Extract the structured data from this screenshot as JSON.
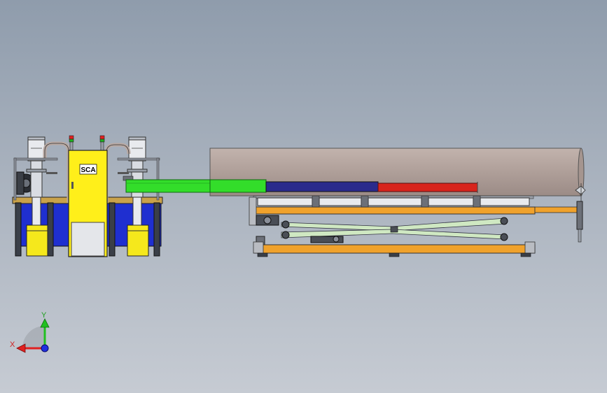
{
  "cabinet": {
    "label": "SCA"
  },
  "triad": {
    "x_label": "X",
    "y_label": "Y"
  },
  "colors": {
    "background_top": "#8f9cac",
    "background_bottom": "#c6cbd3",
    "tank_blue": "#1f2fd0",
    "cabinet_yellow": "#ffef1a",
    "barrel_yellow": "#f5e81c",
    "pipe_grey": "#b9a9a3",
    "green_rod": "#33dd2a",
    "navy_rod": "#2a2a8c",
    "red_rod": "#d8241c",
    "frame_orange": "#f0a22c",
    "roller_green": "#cfe8c2",
    "axis_red": "#e02020",
    "axis_green": "#20c020",
    "axis_blue": "#2030e0"
  }
}
